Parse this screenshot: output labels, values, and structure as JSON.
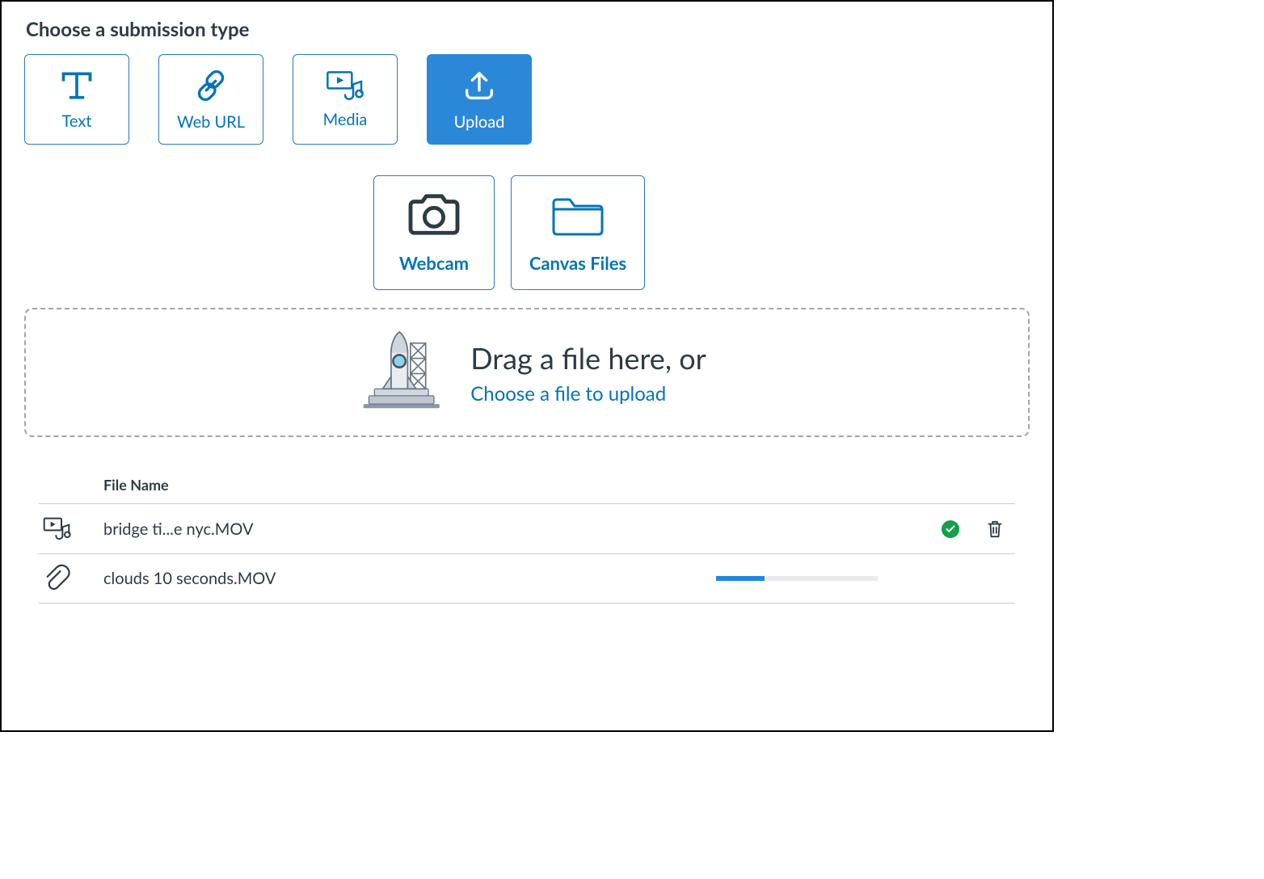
{
  "header": {
    "title": "Choose a submission type"
  },
  "types": {
    "text": {
      "label": "Text"
    },
    "weburl": {
      "label": "Web URL"
    },
    "media": {
      "label": "Media"
    },
    "upload": {
      "label": "Upload"
    }
  },
  "upload_options": {
    "webcam": {
      "label": "Webcam"
    },
    "files": {
      "label": "Canvas Files"
    }
  },
  "dropzone": {
    "title": "Drag a file here, or",
    "link": "Choose a file to upload"
  },
  "file_table": {
    "column_header": "File Name",
    "rows": [
      {
        "name": "bridge ti...e nyc.MOV",
        "status": "done",
        "progress": 100
      },
      {
        "name": "clouds 10 seconds.MOV",
        "status": "uploading",
        "progress": 30
      }
    ]
  },
  "colors": {
    "accent": "#0374B5",
    "active_bg": "#2B88D9",
    "success": "#13A04A",
    "text": "#2D3B45",
    "border": "#C7CDD1"
  }
}
